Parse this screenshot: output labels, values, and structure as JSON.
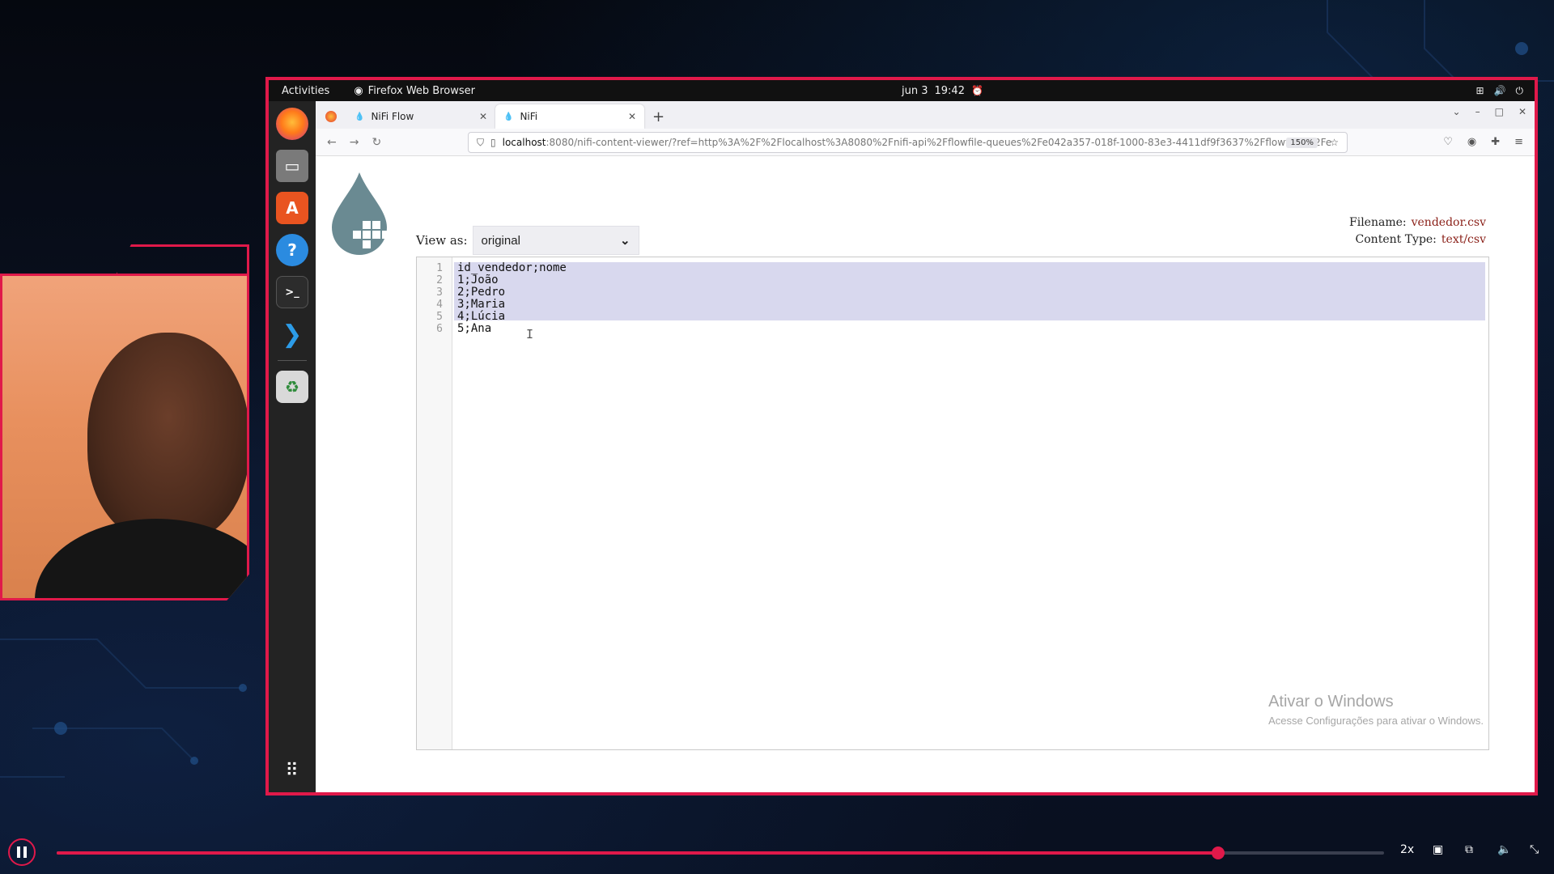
{
  "desktop": {
    "activities": "Activities",
    "app_name": "Firefox Web Browser",
    "date": "jun 3",
    "time": "19:42"
  },
  "browser": {
    "tabs": [
      {
        "label": "NiFi Flow"
      },
      {
        "label": "NiFi"
      }
    ],
    "url_host": "localhost",
    "url_path": ":8080/nifi-content-viewer/?ref=http%3A%2F%2Flocalhost%3A8080%2Fnifi-api%2Fflowfile-queues%2Fe042a357-018f-1000-83e3-4411df9f3637%2Fflowfiles%2Fe",
    "zoom": "150%"
  },
  "viewer": {
    "view_as_label": "View as:",
    "view_as_value": "original",
    "filename_label": "Filename:",
    "filename_value": "vendedor.csv",
    "content_type_label": "Content Type:",
    "content_type_value": "text/csv",
    "lines": [
      {
        "num": "1",
        "text": "id_vendedor;nome"
      },
      {
        "num": "2",
        "text": "1;João"
      },
      {
        "num": "3",
        "text": "2;Pedro"
      },
      {
        "num": "4",
        "text": "3;Maria"
      },
      {
        "num": "5",
        "text": "4;Lúcia"
      },
      {
        "num": "6",
        "text": "5;Ana"
      }
    ]
  },
  "watermark": {
    "title": "Ativar o Windows",
    "subtitle": "Acesse Configurações para ativar o Windows."
  },
  "player": {
    "speed": "2x",
    "progress": 0.875
  },
  "colors": {
    "accent": "#e0194a",
    "nifi_value": "#8a1f17",
    "selection": "#d8d8ee"
  }
}
